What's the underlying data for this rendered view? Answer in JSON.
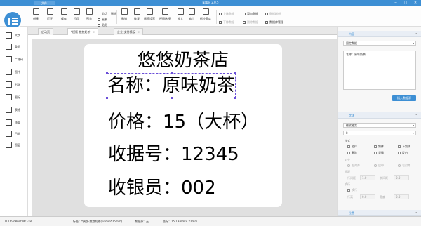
{
  "titlebar": {
    "file_tab": "文件",
    "title": "Nabel 2.0.5",
    "minimize": "─",
    "maximize": "□",
    "close": "✕"
  },
  "toolbar": {
    "new": "新建",
    "open": "打开",
    "save": "保存",
    "print": "打印",
    "preview": "预览",
    "cut": "剪切",
    "copy": "复制",
    "paste": "粘贴",
    "delete": "删除",
    "undo": "撤销",
    "redo": "恢复",
    "label_settings": "标签设置",
    "view_settings": "视图选择",
    "zoom_in": "放大",
    "zoom_out": "缩小",
    "fit": "适应宽度",
    "move_up": "上移数据",
    "move_down": "下移数据",
    "add_data": "添加数据",
    "delete_data": "删除数据",
    "data_refresh": "数据刷新",
    "data_source_mgmt": "数据库管理"
  },
  "left_tools": [
    {
      "label": "文字",
      "icon": "text-icon"
    },
    {
      "label": "条码",
      "icon": "barcode-icon"
    },
    {
      "label": "二维码",
      "icon": "qrcode-icon"
    },
    {
      "label": "图片",
      "icon": "image-icon"
    },
    {
      "label": "形状",
      "icon": "shape-icon"
    },
    {
      "label": "图标",
      "icon": "clipart-icon"
    },
    {
      "label": "表格",
      "icon": "table-icon"
    },
    {
      "label": "线条",
      "icon": "line-icon"
    },
    {
      "label": "日期",
      "icon": "date-icon"
    },
    {
      "label": "图层",
      "icon": "layer-icon"
    }
  ],
  "doc_tabs": [
    {
      "label": "启动页"
    },
    {
      "label": "*模版-悠悠奶茶"
    },
    {
      "label": "企业-支持模板"
    }
  ],
  "label": {
    "shop_name": "悠悠奶茶店",
    "product_name": "名称：原味奶茶",
    "price": "价格：15（大杯）",
    "receipt_no": "收据号：12345",
    "cashier": "收银员：002"
  },
  "right_panel": {
    "content": {
      "header": "内容",
      "source_type": "固定数据",
      "text_value": "名称：原味奶茶",
      "insert_button": "插入数据源"
    },
    "font": {
      "header": "字体",
      "family": "微软雅黑",
      "size": "8",
      "style_label": "样式",
      "bold": "粗体",
      "italic": "斜体",
      "underline": "下划线",
      "strike": "删除",
      "vertical": "竖排",
      "reverse": "反白",
      "align_label": "对齐",
      "align_left": "左对齐",
      "align_center": "居中",
      "align_right": "右对齐",
      "spacing_label": "间距",
      "line_spacing": "行间距",
      "line_spacing_value": "1.0",
      "char_spacing": "字间距",
      "char_spacing_value": "0.0",
      "wrap_label": "换行",
      "auto_wrap": "换行",
      "row_height": "行高",
      "row_height_value": "0.0",
      "width": "宽度",
      "width_value": "0.0"
    },
    "position": {
      "header": "位置"
    }
  },
  "statusbar": {
    "printer": "TT DoroPrint MC-18",
    "label_info": "标签：*模版-悠悠奶茶(50mm*25mm)",
    "data_info": "数据源：无",
    "coordinates": "坐标：15.13mm,9.22mm"
  }
}
